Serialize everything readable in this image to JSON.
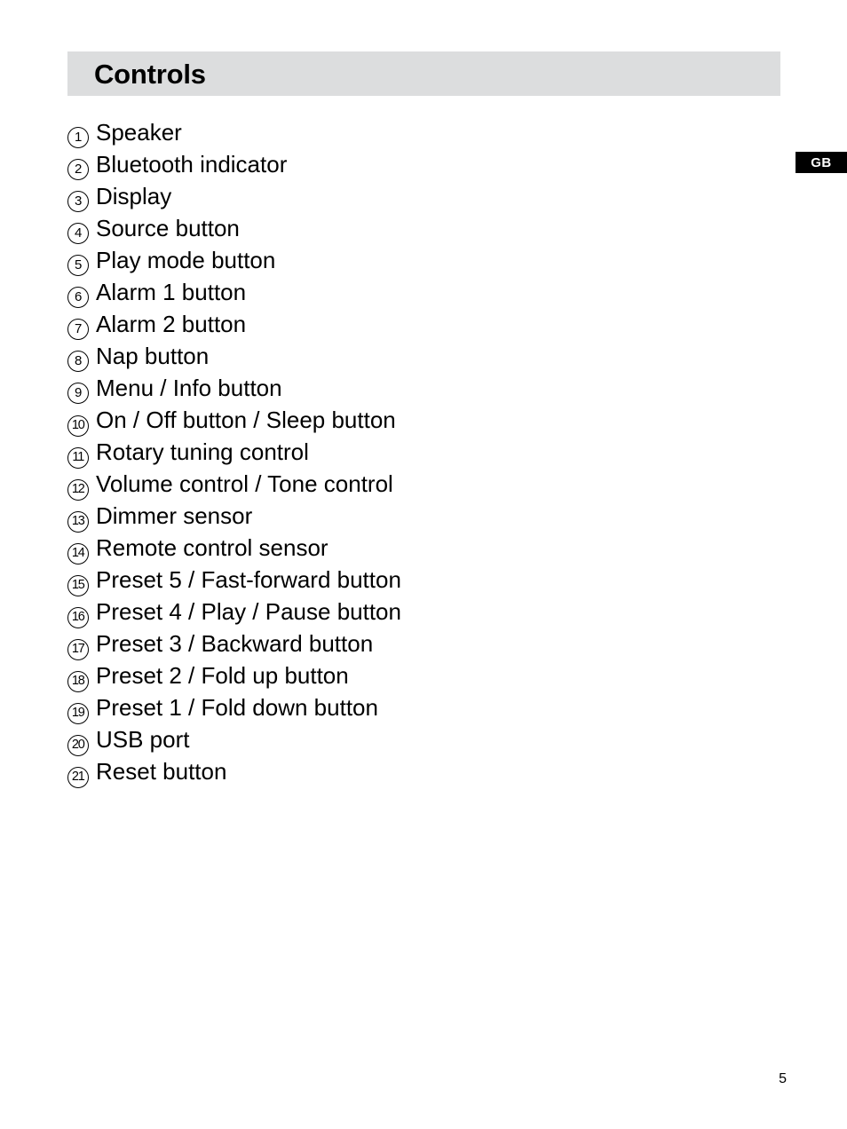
{
  "page": {
    "background_color": "#ffffff",
    "number": "5"
  },
  "language_badge": {
    "label": "GB",
    "background_color": "#000000",
    "text_color": "#ffffff"
  },
  "section": {
    "title": "Controls",
    "band_color": "#dcddde"
  },
  "controls": {
    "items": [
      {
        "number": "1",
        "label": "Speaker"
      },
      {
        "number": "2",
        "label": "Bluetooth indicator"
      },
      {
        "number": "3",
        "label": "Display"
      },
      {
        "number": "4",
        "label": "Source button"
      },
      {
        "number": "5",
        "label": "Play mode button"
      },
      {
        "number": "6",
        "label": "Alarm 1 button"
      },
      {
        "number": "7",
        "label": "Alarm 2 button"
      },
      {
        "number": "8",
        "label": "Nap button"
      },
      {
        "number": "9",
        "label": "Menu / Info button"
      },
      {
        "number": "10",
        "label": "On / Off button / Sleep button"
      },
      {
        "number": "11",
        "label": "Rotary tuning control"
      },
      {
        "number": "12",
        "label": "Volume control / Tone control"
      },
      {
        "number": "13",
        "label": "Dimmer sensor"
      },
      {
        "number": "14",
        "label": "Remote control sensor"
      },
      {
        "number": "15",
        "label": "Preset 5 / Fast-forward button"
      },
      {
        "number": "16",
        "label": "Preset 4 / Play / Pause button"
      },
      {
        "number": "17",
        "label": "Preset 3 / Backward button"
      },
      {
        "number": "18",
        "label": "Preset 2 / Fold up button"
      },
      {
        "number": "19",
        "label": "Preset 1 / Fold down button"
      },
      {
        "number": "20",
        "label": "USB port"
      },
      {
        "number": "21",
        "label": "Reset button"
      }
    ]
  }
}
